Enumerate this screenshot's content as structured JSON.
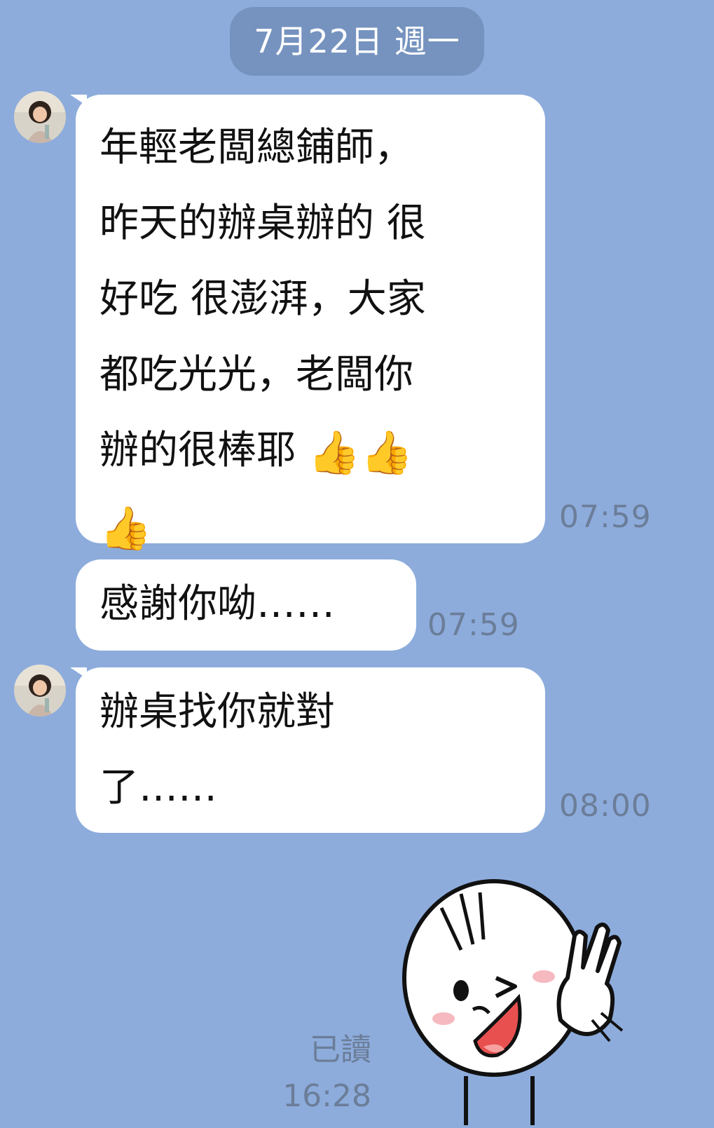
{
  "chat": {
    "date_label": "7月22日 週一",
    "messages": [
      {
        "sender": "other",
        "lines": [
          "年輕老闆總鋪師，",
          "昨天的辦桌辦的 很",
          "好吃 很澎湃，大家",
          "都吃光光，老闆你",
          "辦的很棒耶"
        ],
        "emoji": "👍",
        "time": "07:59"
      },
      {
        "sender": "other",
        "lines": [
          "感謝你呦……"
        ],
        "time": "07:59"
      },
      {
        "sender": "other",
        "lines": [
          "辦桌找你就對",
          "了……"
        ],
        "time": "08:00"
      }
    ],
    "outgoing": {
      "read_status": "已讀",
      "time": "16:28",
      "sticker_name": "waving-cartoon-sticker"
    }
  },
  "colors": {
    "background": "#8dacdc",
    "bubble": "#ffffff",
    "date_pill": "#7693bf",
    "timestamp": "#6b7d98",
    "thumbs_up": "#f2a900"
  },
  "icons": {
    "avatar": "profile-photo-avatar",
    "thumbs_up": "thumbs-up-icon"
  }
}
